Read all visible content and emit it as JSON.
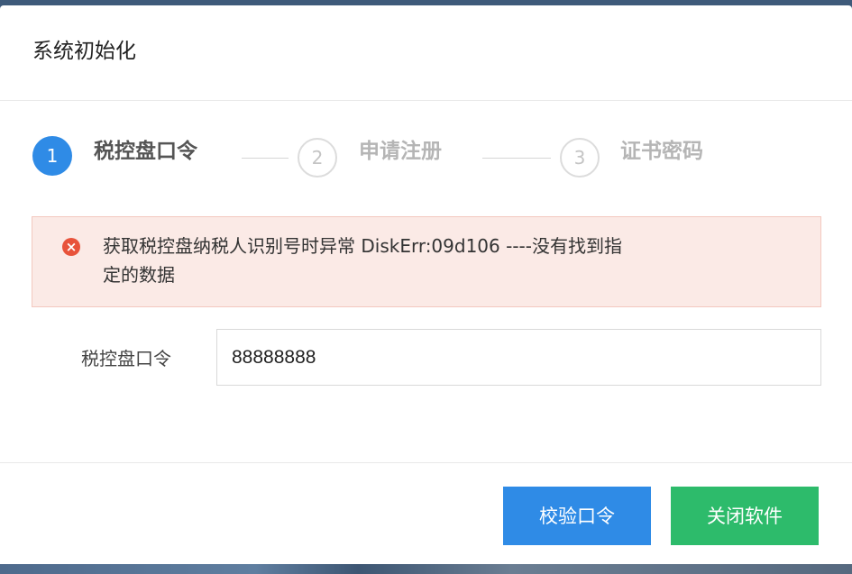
{
  "dialog": {
    "title": "系统初始化"
  },
  "steps": [
    {
      "number": "1",
      "label": "税控盘口令",
      "state": "active"
    },
    {
      "number": "2",
      "label": "申请注册",
      "state": "inactive"
    },
    {
      "number": "3",
      "label": "证书密码",
      "state": "inactive"
    }
  ],
  "alert": {
    "icon": "error-circle-icon",
    "line1": "获取税控盘纳税人识别号时异常 DiskErr:09d106 ----没有找到指",
    "line2": "定的数据"
  },
  "form": {
    "label": "税控盘口令",
    "value": "88888888"
  },
  "buttons": {
    "verify": "校验口令",
    "close": "关闭软件"
  },
  "colors": {
    "primary": "#2f8be6",
    "success": "#2dbb6b",
    "error": "#e8533b",
    "alert_bg": "#fbeae6"
  }
}
